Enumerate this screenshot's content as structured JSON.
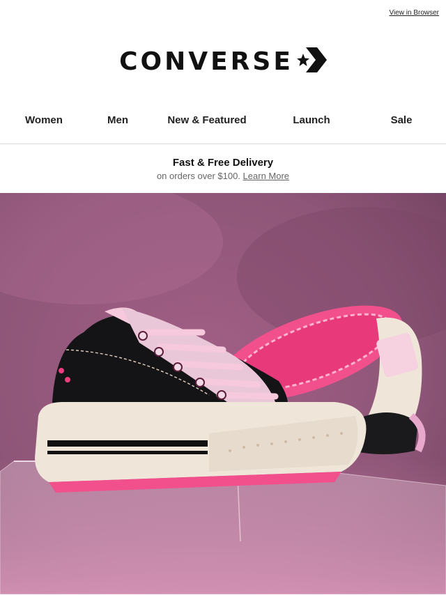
{
  "header": {
    "view_in_browser": "View in Browser",
    "logo_text": "CONVERSE"
  },
  "nav": [
    {
      "label": "Women"
    },
    {
      "label": "Men"
    },
    {
      "label": "New & Featured"
    },
    {
      "label": "Launch"
    },
    {
      "label": "Sale"
    }
  ],
  "promo": {
    "title": "Fast & Free Delivery",
    "subtitle": "on orders over $100.",
    "link": "Learn More"
  },
  "hero": {
    "icons": [
      "sneaker-image"
    ],
    "colors": {
      "background": "#8e5678",
      "accent": "#ee3d7e",
      "sole": "#efe6d9",
      "upper": "#141316",
      "laces": "#f6c9dc"
    }
  }
}
